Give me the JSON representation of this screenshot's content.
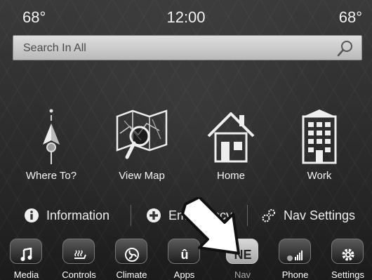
{
  "status": {
    "temp_left": "68°",
    "clock": "12:00",
    "temp_right": "68°"
  },
  "search": {
    "placeholder": "Search In All"
  },
  "destinations": [
    {
      "label": "Where To?",
      "icon": "where-to-icon"
    },
    {
      "label": "View Map",
      "icon": "map-icon"
    },
    {
      "label": "Home",
      "icon": "home-icon"
    },
    {
      "label": "Work",
      "icon": "work-building-icon"
    }
  ],
  "quickbar": {
    "information": "Information",
    "emergency": "Emergency",
    "nav_settings": "Nav Settings"
  },
  "tabs": [
    {
      "label": "Media",
      "icon": "music-note-icon"
    },
    {
      "label": "Controls",
      "icon": "seat-heater-icon"
    },
    {
      "label": "Climate",
      "icon": "fan-icon"
    },
    {
      "label": "Apps",
      "icon": "uconnect-icon",
      "glyph": "û"
    },
    {
      "label": "Nav",
      "icon": "compass-icon",
      "glyph": "NE"
    },
    {
      "label": "Phone",
      "icon": "phone-signal-icon"
    },
    {
      "label": "Settings",
      "icon": "gear-icon"
    }
  ],
  "colors": {
    "text": "#ffffff",
    "background": "#2a2a2a",
    "search_bar": "#cfcfcf",
    "active_tab": "#c8c8c8"
  }
}
